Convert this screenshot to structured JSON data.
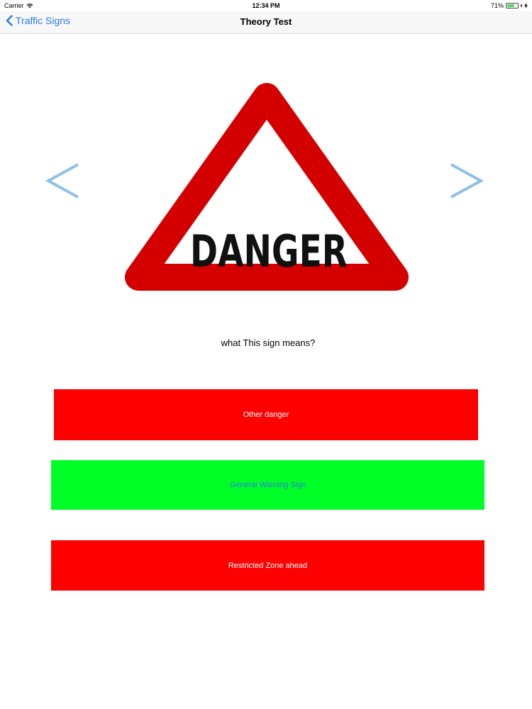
{
  "status_bar": {
    "carrier": "Carrier",
    "time": "12:34 PM",
    "battery": "71%",
    "battery_level": 0.71
  },
  "nav": {
    "back_label": "Traffic Signs",
    "title": "Theory Test"
  },
  "sign": {
    "text": "DANGER",
    "border_color": "#d40000",
    "text_color": "#111111"
  },
  "question": "what This sign means?",
  "answers": [
    {
      "label": "Other danger",
      "bg": "#ff0000",
      "fg": "#ffffff"
    },
    {
      "label": "General Warning Sign",
      "bg": "#00ff26",
      "fg": "#2a7be4"
    },
    {
      "label": "Restricted Zone ahead",
      "bg": "#ff0000",
      "fg": "#ffffff"
    }
  ],
  "colors": {
    "accent": "#2a7be4",
    "arrow": "#8ec1e8"
  },
  "icons": {
    "back": "chevron-left-icon",
    "prev": "arrow-prev-icon",
    "next": "arrow-next-icon",
    "wifi": "wifi-icon",
    "battery": "battery-icon"
  }
}
